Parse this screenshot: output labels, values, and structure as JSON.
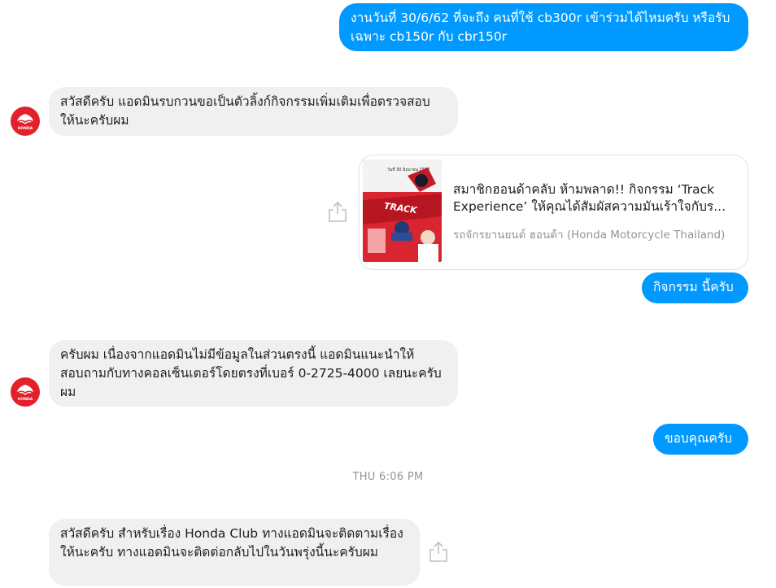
{
  "messages": [
    {
      "text": "งานวันที่ 30/6/62 ที่จะถึง คนที่ใช้ cb300r เข้าร่วมได้ไหมครับ หรือรับเฉพาะ cb150r กับ cbr150r"
    },
    {
      "text": "สวัสดีครับ แอดมินรบกวนขอเป็นตัวลิ้งก์กิจกรรมเพิ่มเติมเพื่อตรวจสอบให้นะครับผม"
    },
    {
      "text": "กิจกรรม นี้ครับ"
    },
    {
      "text": "ครับผม เนื่องจากแอดมินไม่มีข้อมูลในส่วนตรงนี้ แอดมินแนะนำให้สอบถามกับทางคอลเซ็นเตอร์โดยตรงที่เบอร์ 0-2725-4000 เลยนะครับผม"
    },
    {
      "text": "ขอบคุณครับ"
    },
    {
      "text": "สวัสดีครับ สำหรับเรื่อง Honda Club ทางแอดมินจะติดตามเรื่องให้นะครับ ทางแอดมินจะติดต่อกลับไปในวันพรุ่งนี้นะครับผม"
    }
  ],
  "link_card": {
    "title": "สมาชิกฮอนด้าคลับ ห้ามพลาด!! กิจกรรม ‘Track Experience’ ให้คุณได้สัมผัสความมันเร้าใจกับร...",
    "source": "รถจักรยานยนต์ ฮอนด้า (Honda Motorcycle Thailand)",
    "thumb_text": "TRACK",
    "thumb_date": "วันที่ 30 มิถุนายน 2562"
  },
  "timestamp": "THU 6:06 PM",
  "avatar_label": "HONDA",
  "colors": {
    "outgoing_bubble": "#0099ff",
    "incoming_bubble": "#f0f0f0",
    "avatar_bg": "#e4202b",
    "meta_text": "#90949c"
  },
  "icons": {
    "avatar": "honda-wing-logo",
    "share": "share-icon"
  }
}
